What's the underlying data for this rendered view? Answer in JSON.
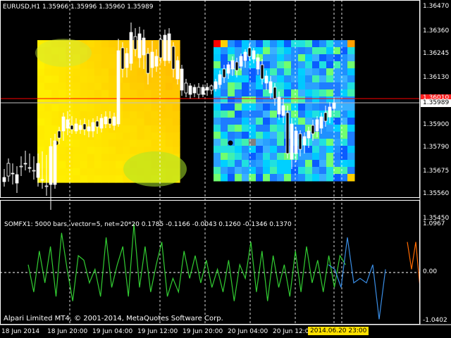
{
  "colors": {
    "background": "#000000",
    "grid": "#ffffff",
    "bull_candle": "#ffffff",
    "bear_candle": "#000000",
    "resistance_line": "#ff0000",
    "ask_line": "#c0c0c0",
    "oscillator_green": "#32cd32",
    "oscillator_blue": "#3a8ee6",
    "oscillator_orange": "#ff6a00",
    "current_price_box": "#ff2020",
    "date_highlight": "#ffe000"
  },
  "main_chart": {
    "header": "EURUSD,H1  1.35966 1.35996 1.35960 1.35989",
    "price_ticks": [
      "1.36470",
      "1.36360",
      "1.36245",
      "1.36130",
      "1.35900",
      "1.35790",
      "1.35675",
      "1.35560",
      "1.35450"
    ],
    "current_price_red": "1.36010",
    "current_price": "1.35989"
  },
  "indicator": {
    "header": "SOMFX1: 5000 bars, vector=5, net=20*20 0.1785 -0.1166 -0.0043 0.1260 -0.1346 0.1370",
    "ticks": [
      "1.0967",
      "0.00",
      "-1.0402"
    ],
    "copyright": "Alpari Limited MT4, © 2001-2014, MetaQuotes Software Corp."
  },
  "time_axis": {
    "labels": [
      "18 Jun 2014",
      "18 Jun 20:00",
      "19 Jun 04:00",
      "19 Jun 12:00",
      "19 Jun 20:00",
      "20 Jun 04:00",
      "20 Jun 12:00"
    ],
    "highlighted": "2014.06.20 23:00"
  },
  "chart_data": {
    "type": "line",
    "title": "",
    "series": [
      {
        "values": [
          0.2,
          -0.4,
          0.5,
          -0.2,
          0.6,
          -0.5,
          0.9,
          0.1,
          -0.6,
          0.4,
          0.3,
          -0.2,
          0.1,
          -0.5,
          0.8,
          -0.3,
          0.2,
          0.6,
          -0.5,
          1.1,
          -0.3,
          0.6,
          -0.4,
          0.2,
          0.7,
          -0.5,
          -0.1,
          -0.4,
          0.5,
          -0.1,
          0.4,
          -0.2,
          0.3,
          -0.3,
          0.1,
          -0.4,
          0.3,
          -0.6,
          0.2,
          -0.1,
          0.7,
          -0.4,
          0.5,
          -0.6,
          0.4,
          -0.3,
          0.2,
          -0.5,
          0.5,
          -0.4,
          0.6,
          -0.2,
          0.3,
          -0.4,
          0.4,
          -0.3,
          0.4,
          0.2
        ]
      },
      {
        "values": [
          0.2,
          0.1,
          -0.3,
          0.8,
          -0.2,
          -0.1,
          -0.2,
          0.2,
          -1.0,
          0.1
        ]
      },
      {
        "values": [
          0.7,
          0.1,
          0.7,
          -0.3
        ]
      }
    ],
    "ylim": [
      -1.0402,
      1.0967
    ]
  }
}
